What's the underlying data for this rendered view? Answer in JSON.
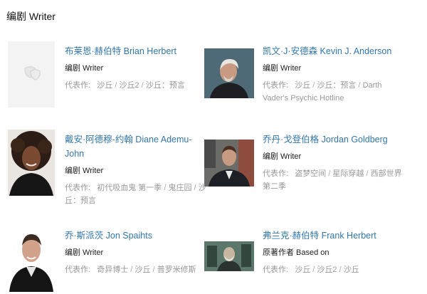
{
  "section": {
    "title": "编剧 Writer"
  },
  "works_prefix": "代表作:",
  "separator": " / ",
  "people": [
    {
      "name": "布莱恩·赫伯特 Brian Herbert",
      "role": "编剧 Writer",
      "works": [
        "沙丘",
        "沙丘2",
        "沙丘：预言"
      ],
      "avatar": "placeholder-masks-icon"
    },
    {
      "name": "凯文·J·安德森 Kevin J. Anderson",
      "role": "编剧 Writer",
      "works": [
        "沙丘",
        "沙丘：预言",
        "Darth Vader's Psychic Hotline"
      ],
      "avatar": "photo"
    },
    {
      "name": "戴安·阿德穆-约翰 Diane Ademu-John",
      "role": "编剧 Writer",
      "works": [
        "初代吸血鬼 第一季",
        "鬼庄园",
        "沙丘：预言"
      ],
      "avatar": "photo"
    },
    {
      "name": "乔丹·戈登伯格 Jordan Goldberg",
      "role": "编剧 Writer",
      "works": [
        "盗梦空间",
        "星际穿越",
        "西部世界 第二季"
      ],
      "avatar": "photo"
    },
    {
      "name": "乔·斯派茨 Jon Spaihts",
      "role": "编剧 Writer",
      "works": [
        "奇异博士",
        "沙丘",
        "普罗米修斯"
      ],
      "avatar": "photo"
    },
    {
      "name": "弗兰克·赫伯特 Frank Herbert",
      "role": "原著作者 Based on",
      "works": [
        "沙丘",
        "沙丘2",
        "沙丘"
      ],
      "avatar": "photo"
    }
  ]
}
